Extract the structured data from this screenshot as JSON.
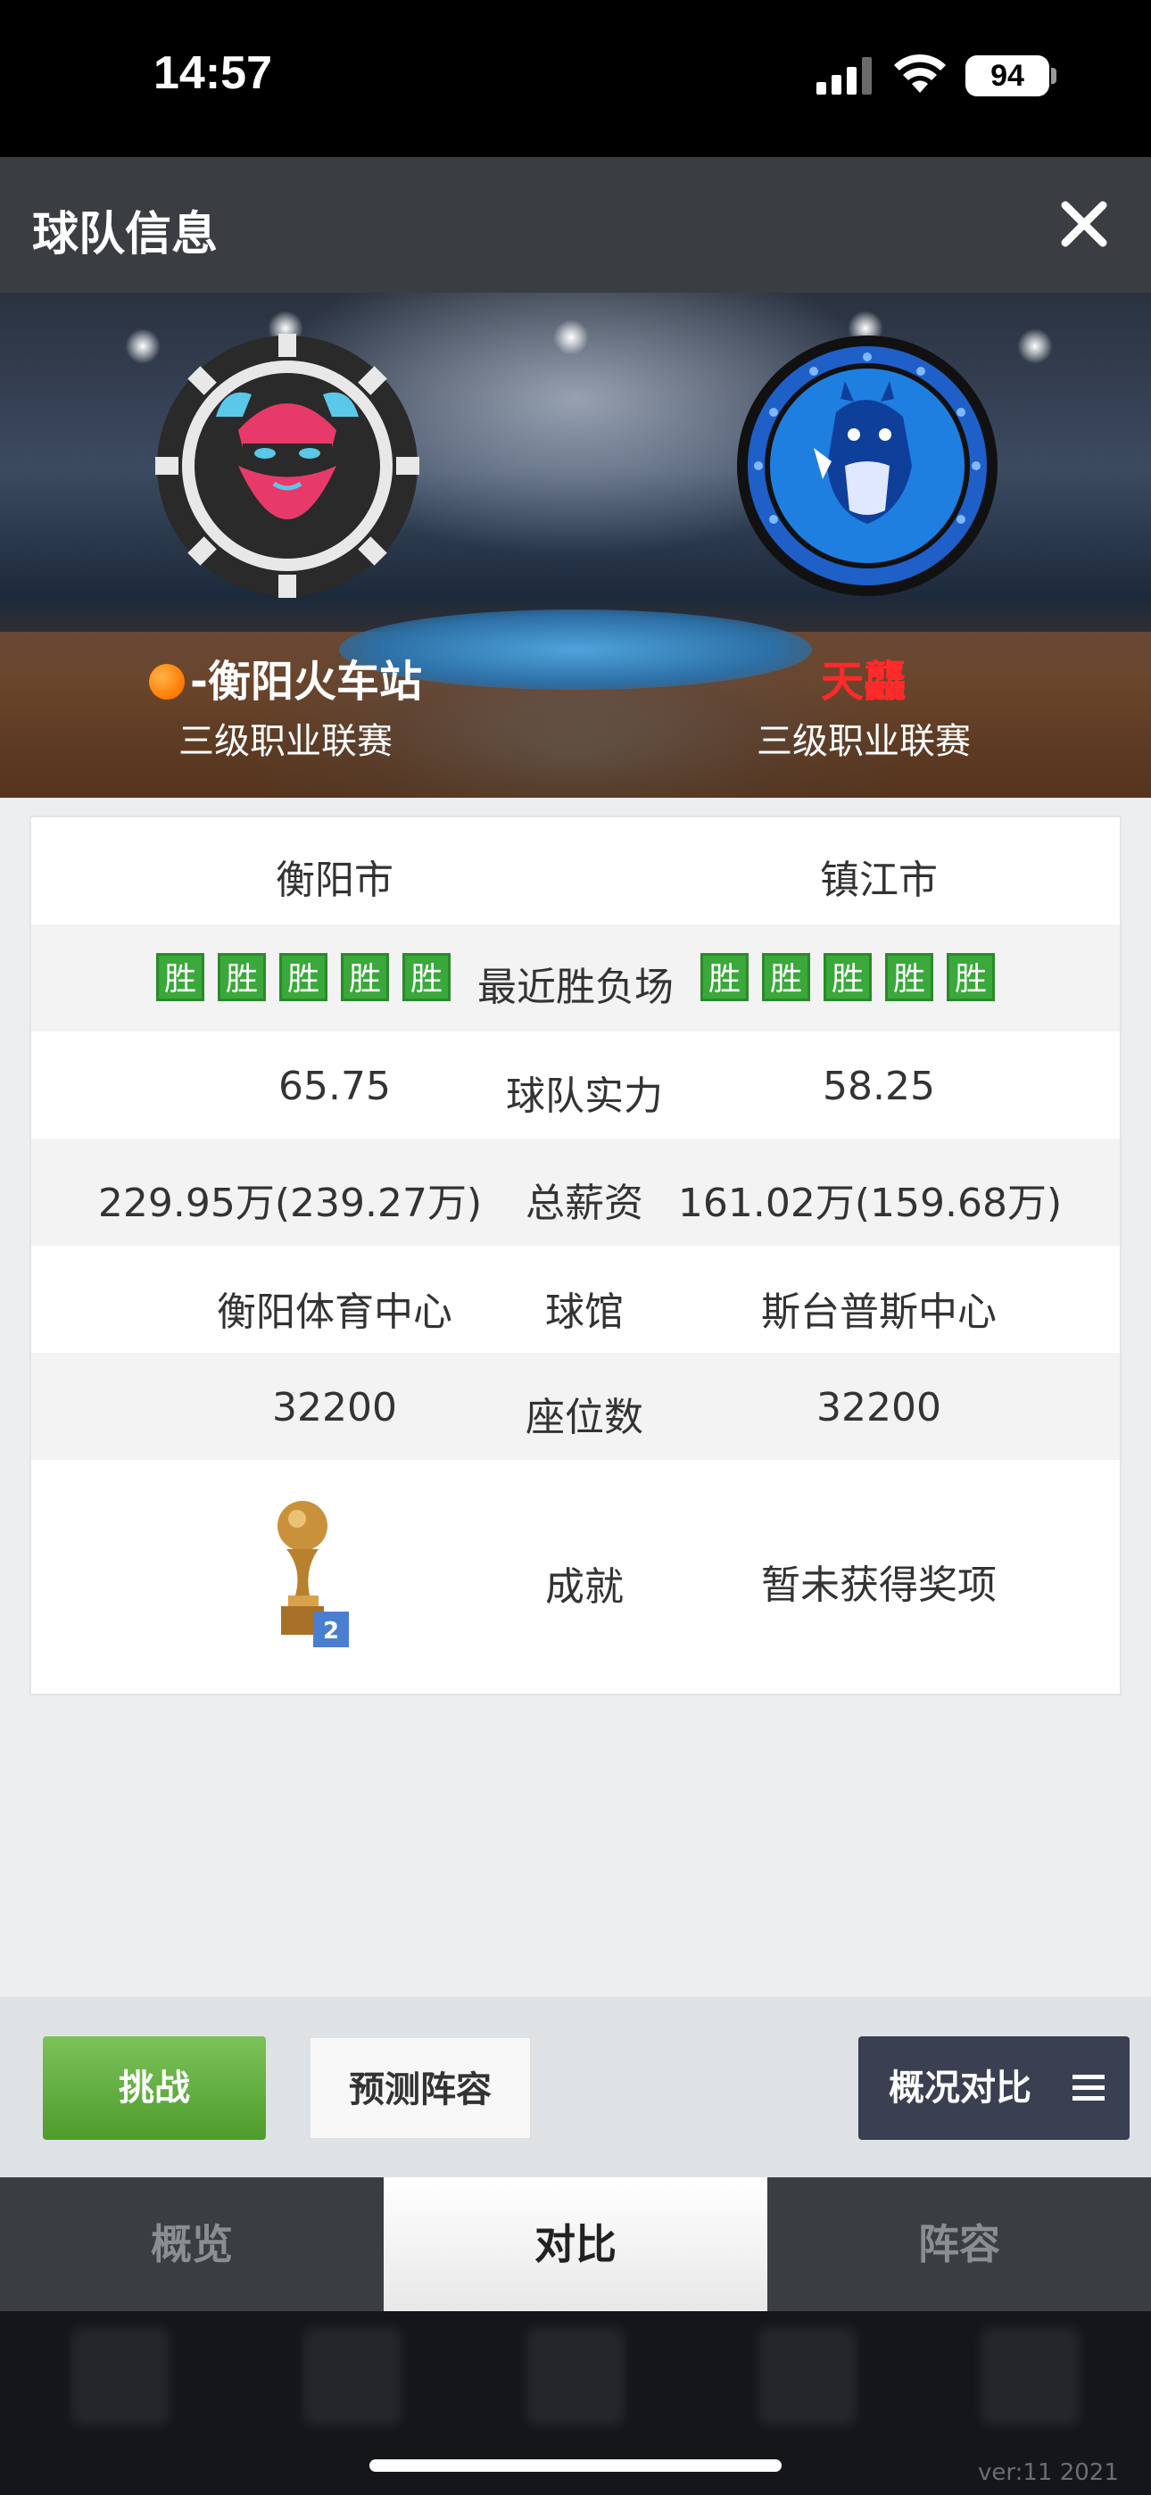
{
  "status_bar": {
    "time": "14:57",
    "battery": "94"
  },
  "header": {
    "title": "球队信息"
  },
  "teams": {
    "home": {
      "name": "-衡阳火车站",
      "league": "三级职业联赛"
    },
    "away": {
      "name": "天龘",
      "league": "三级职业联赛"
    }
  },
  "info": {
    "city": {
      "home": "衡阳市",
      "away": "镇江市"
    },
    "recent": {
      "label": "最近胜负场",
      "home": [
        "胜",
        "胜",
        "胜",
        "胜",
        "胜"
      ],
      "away": [
        "胜",
        "胜",
        "胜",
        "胜",
        "胜"
      ]
    },
    "strength": {
      "label": "球队实力",
      "home": "65.75",
      "away": "58.25"
    },
    "salary": {
      "label": "总薪资",
      "home": "229.95万(239.27万)",
      "away": "161.02万(159.68万)"
    },
    "arena": {
      "label": "球馆",
      "home": "衡阳体育中心",
      "away": "斯台普斯中心"
    },
    "seats": {
      "label": "座位数",
      "home": "32200",
      "away": "32200"
    },
    "achievement": {
      "label": "成就",
      "home_trophy_count": "2",
      "away": "暂未获得奖项"
    }
  },
  "buttons": {
    "challenge": "挑战",
    "predict": "预测阵容",
    "compare": "概况对比"
  },
  "tabs": [
    "概览",
    "对比",
    "阵容"
  ],
  "active_tab": 1,
  "version": "ver:11 2021",
  "colors": {
    "win_badge": "#3aa83a",
    "away_name": "#ff2a2a",
    "header_bg": "#3a3d42"
  }
}
